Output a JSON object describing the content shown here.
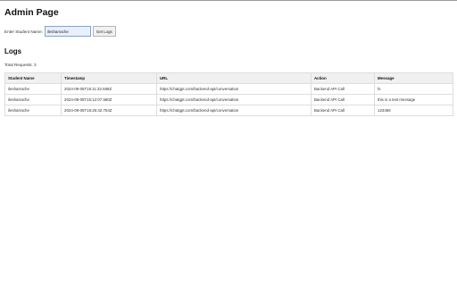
{
  "page": {
    "title": "Admin Page"
  },
  "form": {
    "label": "Enter Student Name:",
    "input_value": "ilesharrache",
    "button_label": "Get Logs"
  },
  "logs": {
    "heading": "Logs",
    "total_text": "Total Requests: 3",
    "columns": [
      "Student Name",
      "Timestamp",
      "URL",
      "Action",
      "Message"
    ],
    "rows": [
      [
        "ilesharrache",
        "2024-09-05T15:11:32.558Z",
        "https://chatgpt.com/backend-api/conversation",
        "Backend API Call",
        "hi"
      ],
      [
        "ilesharrache",
        "2024-09-05T15:12:07.580Z",
        "https://chatgpt.com/backend-api/conversation",
        "Backend API Call",
        "this is a test message"
      ],
      [
        "ilesharrache",
        "2024-09-05T16:25:32.754Z",
        "https://chatgpt.com/backend-api/conversation",
        "Backend API Call",
        "123456"
      ]
    ]
  }
}
